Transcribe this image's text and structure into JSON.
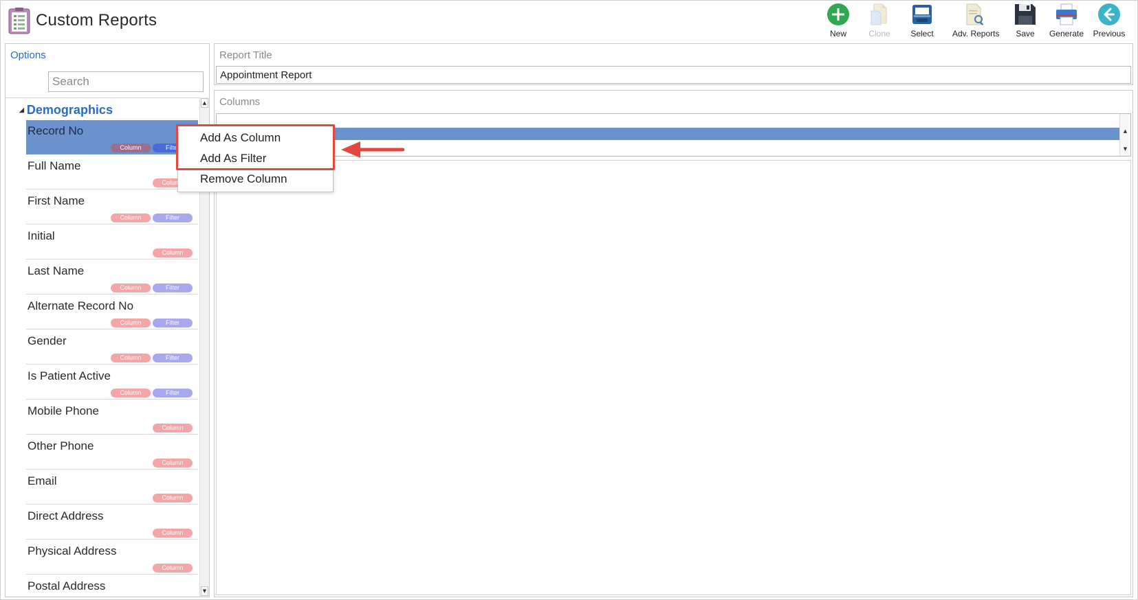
{
  "header": {
    "title": "Custom Reports",
    "app_icon": "report-list-icon"
  },
  "toolbar": {
    "buttons": [
      {
        "label": "New",
        "icon": "plus-circle-icon",
        "enabled": true
      },
      {
        "label": "Clone",
        "icon": "clone-document-icon",
        "enabled": false
      },
      {
        "label": "Select",
        "icon": "inbox-tray-icon",
        "enabled": true
      },
      {
        "label": "Adv. Reports",
        "icon": "document-search-icon",
        "enabled": true
      },
      {
        "label": "Save",
        "icon": "floppy-disk-icon",
        "enabled": true
      },
      {
        "label": "Generate",
        "icon": "printer-icon",
        "enabled": true
      },
      {
        "label": "Previous",
        "icon": "arrow-left-circle-icon",
        "enabled": true
      }
    ]
  },
  "options": {
    "label": "Options",
    "search_placeholder": "Search",
    "group": "Demographics",
    "tag_column": "Column",
    "tag_filter": "Filter",
    "fields": [
      {
        "name": "Record No",
        "column": true,
        "filter": true,
        "selected": true
      },
      {
        "name": "Full Name",
        "column": true,
        "filter": false,
        "selected": false
      },
      {
        "name": "First Name",
        "column": true,
        "filter": true,
        "selected": false
      },
      {
        "name": "Initial",
        "column": true,
        "filter": false,
        "selected": false
      },
      {
        "name": "Last Name",
        "column": true,
        "filter": true,
        "selected": false
      },
      {
        "name": "Alternate Record No",
        "column": true,
        "filter": true,
        "selected": false
      },
      {
        "name": "Gender",
        "column": true,
        "filter": true,
        "selected": false
      },
      {
        "name": "Is Patient Active",
        "column": true,
        "filter": true,
        "selected": false
      },
      {
        "name": "Mobile Phone",
        "column": true,
        "filter": false,
        "selected": false
      },
      {
        "name": "Other Phone",
        "column": true,
        "filter": false,
        "selected": false
      },
      {
        "name": "Email",
        "column": true,
        "filter": false,
        "selected": false
      },
      {
        "name": "Direct Address",
        "column": true,
        "filter": false,
        "selected": false
      },
      {
        "name": "Physical Address",
        "column": true,
        "filter": false,
        "selected": false
      },
      {
        "name": "Postal Address",
        "column": true,
        "filter": false,
        "selected": false
      }
    ]
  },
  "report": {
    "title_label": "Report Title",
    "title_value": "Appointment Report",
    "columns_label": "Columns"
  },
  "context_menu": {
    "items": [
      "Add As Column",
      "Add As Filter",
      "Remove Column"
    ]
  },
  "colors": {
    "accent_blue": "#2a6cc2",
    "selection": "#6b92cc",
    "column_tag": "#f4a5a5",
    "filter_tag": "#a8a8ee",
    "annotation_red": "#e5463d"
  }
}
